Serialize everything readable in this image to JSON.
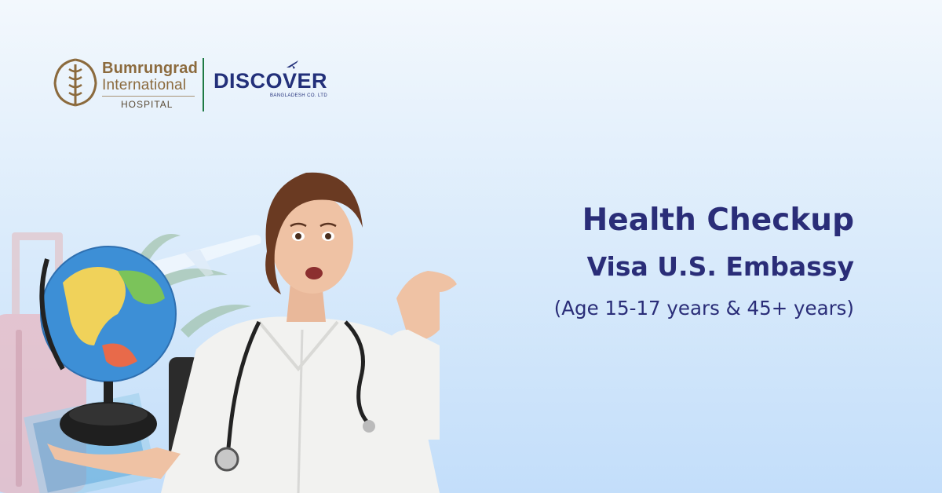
{
  "logos": {
    "bumrungrad": {
      "line1": "Bumrungrad",
      "line2": "International",
      "line3": "HOSPITAL"
    },
    "discover": {
      "name": "DISCOVER",
      "sub": "BANGLADESH CO. LTD"
    }
  },
  "headline": {
    "title": "Health Checkup",
    "subtitle": "Visa U.S. Embassy",
    "detail": "(Age 15-17 years & 45+ years)"
  },
  "colors": {
    "navy": "#2a2d78",
    "gold": "#8b6a3d",
    "green": "#1e7a44",
    "background_top": "#f3f8fd",
    "background_bottom": "#c3defa"
  }
}
